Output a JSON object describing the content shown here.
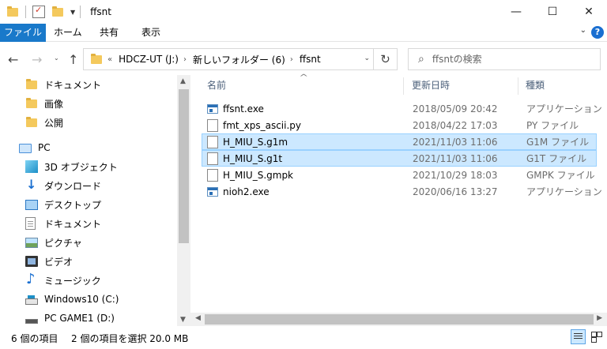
{
  "window": {
    "title": "ffsnt",
    "minimize": "—",
    "maximize": "☐",
    "close": "✕"
  },
  "ribbon": {
    "tabs": [
      "ファイル",
      "ホーム",
      "共有",
      "表示"
    ]
  },
  "nav": {
    "back_glyph": "←",
    "forward_glyph": "→",
    "recent_glyph": "⌄",
    "up_glyph": "↑",
    "refresh_glyph": "↻",
    "crumbs": [
      "HDCZ-UT (J:)",
      "新しいフォルダー (6)",
      "ffsnt"
    ],
    "overflow": "«",
    "crumb_sep": "›",
    "search_placeholder": "ffsntの検索"
  },
  "navpane": {
    "quick_access": [
      {
        "label": "ドキュメント",
        "icon": "folder-icon"
      },
      {
        "label": "画像",
        "icon": "folder-icon"
      },
      {
        "label": "公開",
        "icon": "folder-icon"
      }
    ],
    "pc": {
      "label": "PC",
      "icon": "computer-icon"
    },
    "pc_items": [
      {
        "label": "3D オブジェクト",
        "icon": "3d-objects-icon"
      },
      {
        "label": "ダウンロード",
        "icon": "download-icon"
      },
      {
        "label": "デスクトップ",
        "icon": "desktop-icon"
      },
      {
        "label": "ドキュメント",
        "icon": "documents-icon"
      },
      {
        "label": "ピクチャ",
        "icon": "pictures-icon"
      },
      {
        "label": "ビデオ",
        "icon": "videos-icon"
      },
      {
        "label": "ミュージック",
        "icon": "music-icon"
      },
      {
        "label": "Windows10 (C:)",
        "icon": "system-drive-icon"
      },
      {
        "label": "PC GAME1 (D:)",
        "icon": "drive-icon"
      }
    ]
  },
  "filelist": {
    "columns": {
      "name": "名前",
      "date": "更新日時",
      "type": "種類"
    },
    "rows": [
      {
        "name": "ffsnt.exe",
        "date": "2018/05/09 20:42",
        "type": "アプリケーション",
        "icon": "exe",
        "selected": false
      },
      {
        "name": "fmt_xps_ascii.py",
        "date": "2018/04/22 17:03",
        "type": "PY ファイル",
        "icon": "file",
        "selected": false
      },
      {
        "name": "H_MIU_S.g1m",
        "date": "2021/11/03 11:06",
        "type": "G1M ファイル",
        "icon": "file",
        "selected": true
      },
      {
        "name": "H_MIU_S.g1t",
        "date": "2021/11/03 11:06",
        "type": "G1T ファイル",
        "icon": "file",
        "selected": true
      },
      {
        "name": "H_MIU_S.gmpk",
        "date": "2021/10/29 18:03",
        "type": "GMPK ファイル",
        "icon": "file",
        "selected": false
      },
      {
        "name": "nioh2.exe",
        "date": "2020/06/16 13:27",
        "type": "アプリケーション",
        "icon": "exe",
        "selected": false
      }
    ]
  },
  "statusbar": {
    "count": "6 個の項目",
    "selection": "2 個の項目を選択  20.0 MB"
  }
}
